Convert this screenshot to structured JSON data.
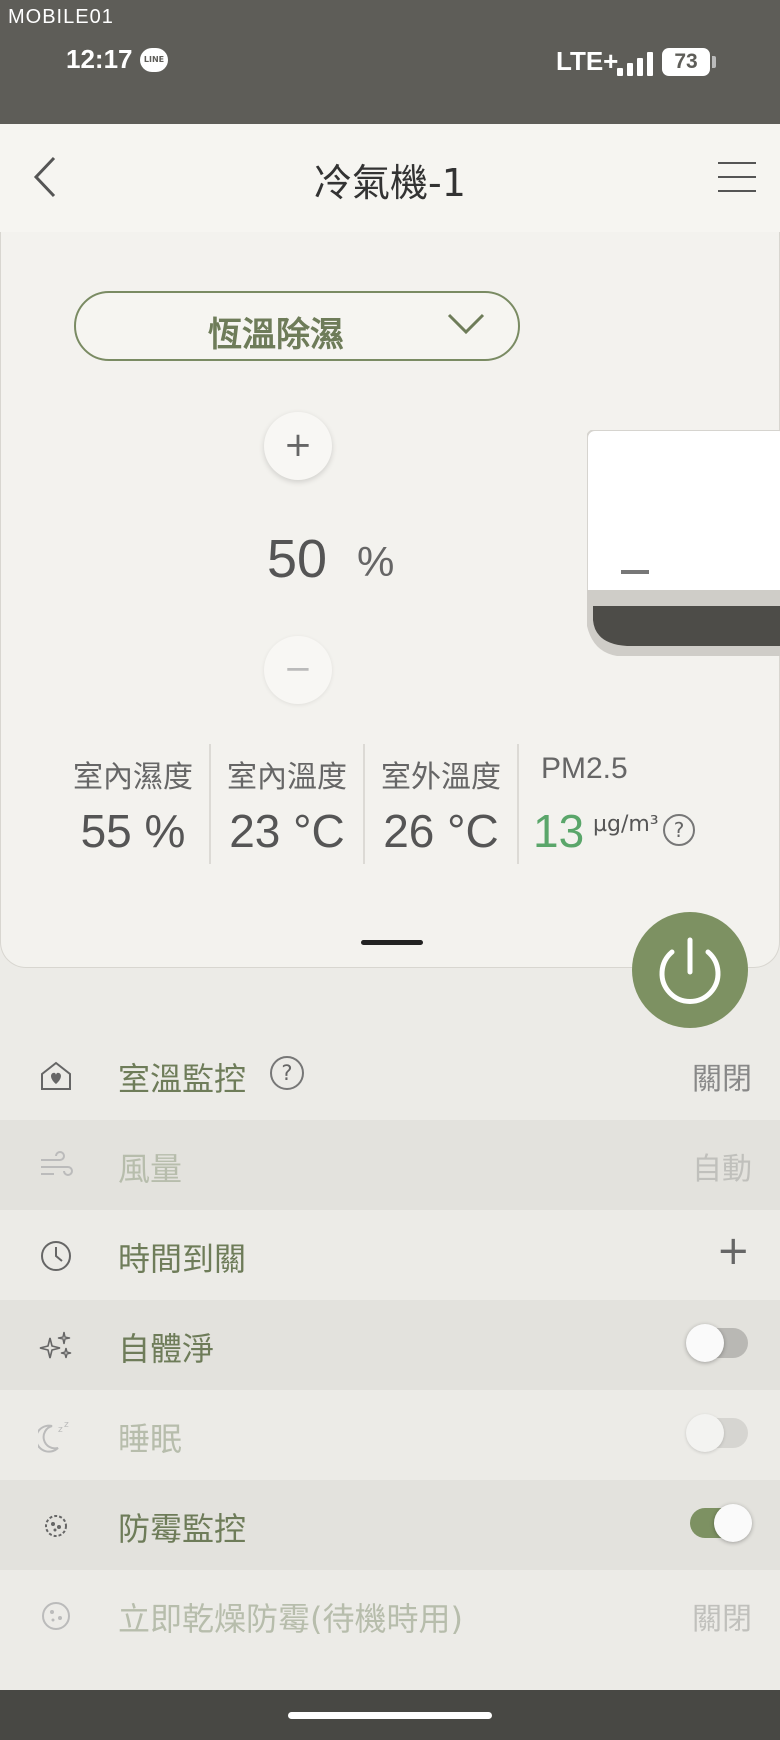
{
  "status_bar": {
    "watermark": "MOBILE01",
    "time": "12:17",
    "line_badge": "LINE",
    "network": "LTE+",
    "battery": "73"
  },
  "header": {
    "title": "冷氣機-1",
    "back_icon": "chevron-left-icon",
    "menu_icon": "hamburger-icon"
  },
  "control": {
    "mode": "恆溫除濕",
    "plus": "+",
    "minus": "−",
    "setpoint": "50",
    "setpoint_unit": "%"
  },
  "stats": [
    {
      "label": "室內濕度",
      "value": "55 %"
    },
    {
      "label": "室內溫度",
      "value": "23 °C"
    },
    {
      "label": "室外溫度",
      "value": "26 °C"
    },
    {
      "label": "PM2.5",
      "value": "13",
      "unit": "µg/m³",
      "help": "?"
    }
  ],
  "rows": {
    "room_monitor": {
      "label": "室溫監控",
      "help": "?",
      "value": "關閉"
    },
    "fan": {
      "label": "風量",
      "value": "自動"
    },
    "timer": {
      "label": "時間到關",
      "action": "+"
    },
    "self_clean": {
      "label": "自體淨",
      "toggle": "off"
    },
    "sleep": {
      "label": "睡眠",
      "toggle": "off-disabled"
    },
    "mold_monitor": {
      "label": "防霉監控",
      "toggle": "on"
    },
    "instant_dry": {
      "label": "立即乾燥防霉(待機時用)",
      "value": "關閉"
    }
  },
  "colors": {
    "accent_green": "#7d9162",
    "pm_green": "#5aa66a",
    "status_bar": "#5e5d58"
  }
}
